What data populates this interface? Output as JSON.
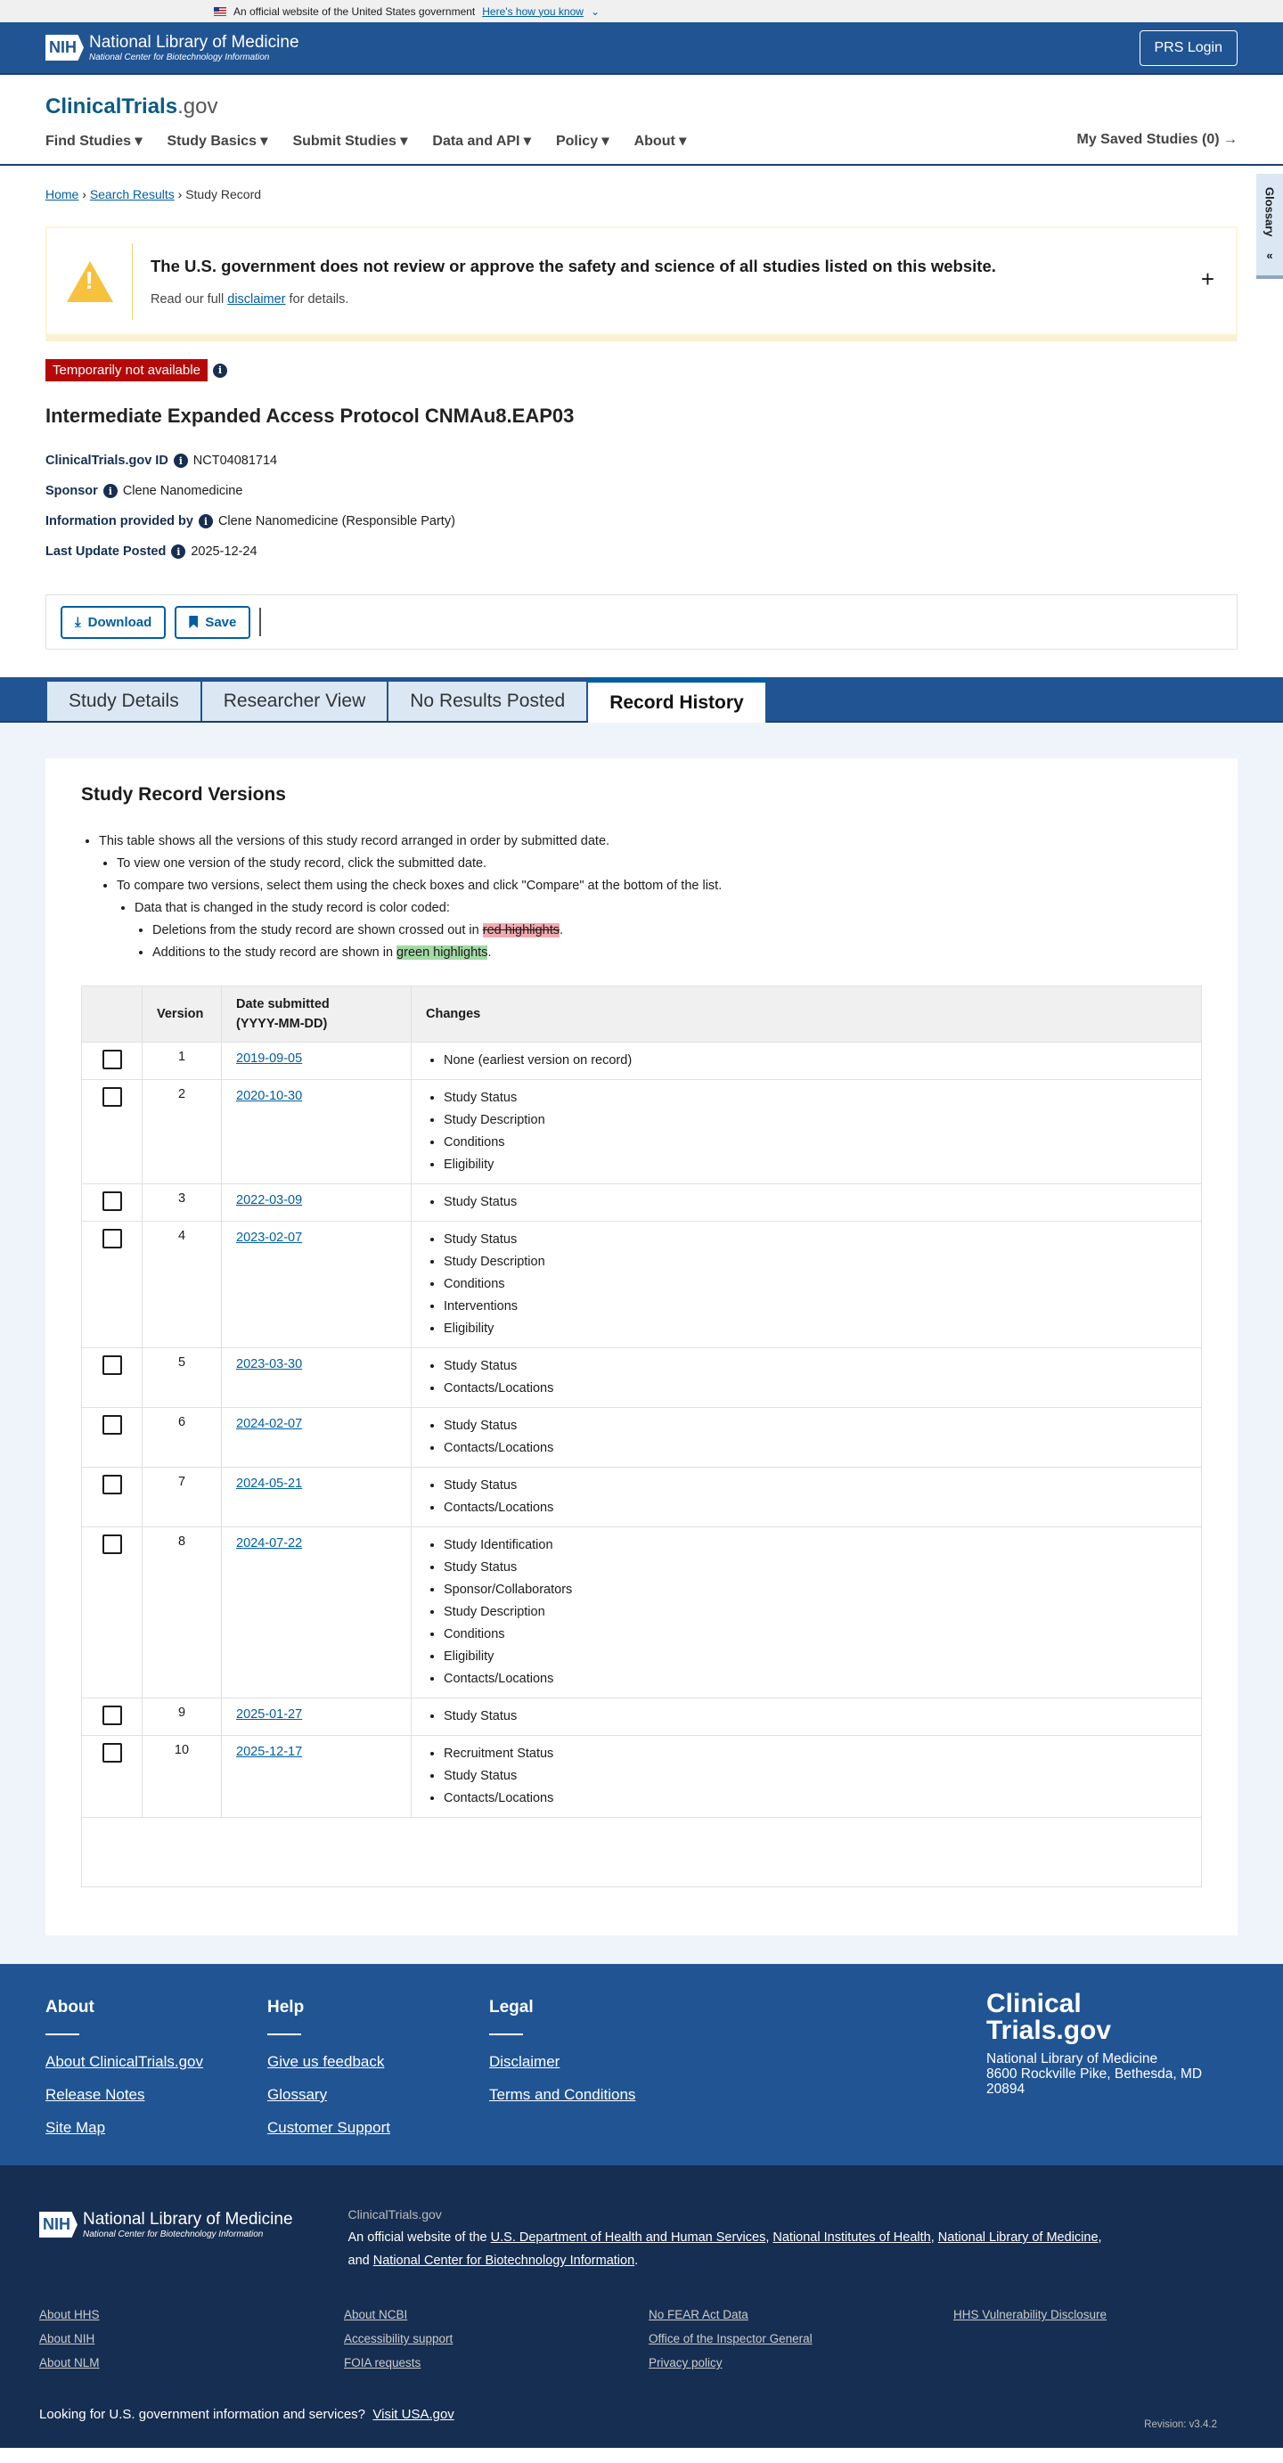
{
  "gov_banner": {
    "text": "An official website of the United States government",
    "link": "Here's how you know"
  },
  "header": {
    "nih_abbr": "NIH",
    "nih_name": "National Library of Medicine",
    "nih_sub": "National Center for Biotechnology Information",
    "prs_login": "PRS Login"
  },
  "site": {
    "logo_main": "ClinicalTrials",
    "logo_suffix": ".gov",
    "nav": [
      "Find Studies",
      "Study Basics",
      "Submit Studies",
      "Data and API",
      "Policy",
      "About"
    ],
    "saved": "My Saved Studies (0)"
  },
  "glossary": "Glossary",
  "breadcrumb": {
    "home": "Home",
    "search": "Search Results",
    "current": "Study Record"
  },
  "disclaimer": {
    "heading": "The U.S. government does not review or approve the safety and science of all studies listed on this website.",
    "pre": "Read our full ",
    "link": "disclaimer",
    "post": " for details."
  },
  "status_badge": "Temporarily not available",
  "study": {
    "title": "Intermediate Expanded Access Protocol CNMAu8.EAP03",
    "meta": [
      {
        "label": "ClinicalTrials.gov ID",
        "value": "NCT04081714"
      },
      {
        "label": "Sponsor",
        "value": "Clene Nanomedicine"
      },
      {
        "label": "Information provided by",
        "value": "Clene Nanomedicine (Responsible Party)"
      },
      {
        "label": "Last Update Posted",
        "value": "2025-12-24"
      }
    ]
  },
  "actions": {
    "download": "Download",
    "save": "Save"
  },
  "tabs": [
    "Study Details",
    "Researcher View",
    "No Results Posted",
    "Record History"
  ],
  "versions": {
    "heading": "Study Record Versions",
    "intro": "This table shows all the versions of this study record arranged in order by submitted date.",
    "view": "To view one version of the study record, click the submitted date.",
    "compare": "To compare two versions, select them using the check boxes and click \"Compare\" at the bottom of the list.",
    "coded": "Data that is changed in the study record is color coded:",
    "del_pre": "Deletions from the study record are shown crossed out in ",
    "del_hl": "red highlights",
    "add_pre": "Additions to the study record are shown in ",
    "add_hl": "green highlights",
    "col_version": "Version",
    "col_date": "Date submitted",
    "col_date_fmt": "(YYYY-MM-DD)",
    "col_changes": "Changes",
    "rows": [
      {
        "version": "1",
        "date": "2019-09-05",
        "changes": [
          "None (earliest version on record)"
        ]
      },
      {
        "version": "2",
        "date": "2020-10-30",
        "changes": [
          "Study Status",
          "Study Description",
          "Conditions",
          "Eligibility"
        ]
      },
      {
        "version": "3",
        "date": "2022-03-09",
        "changes": [
          "Study Status"
        ]
      },
      {
        "version": "4",
        "date": "2023-02-07",
        "changes": [
          "Study Status",
          "Study Description",
          "Conditions",
          "Interventions",
          "Eligibility"
        ]
      },
      {
        "version": "5",
        "date": "2023-03-30",
        "changes": [
          "Study Status",
          "Contacts/Locations"
        ]
      },
      {
        "version": "6",
        "date": "2024-02-07",
        "changes": [
          "Study Status",
          "Contacts/Locations"
        ]
      },
      {
        "version": "7",
        "date": "2024-05-21",
        "changes": [
          "Study Status",
          "Contacts/Locations"
        ]
      },
      {
        "version": "8",
        "date": "2024-07-22",
        "changes": [
          "Study Identification",
          "Study Status",
          "Sponsor/Collaborators",
          "Study Description",
          "Conditions",
          "Eligibility",
          "Contacts/Locations"
        ]
      },
      {
        "version": "9",
        "date": "2025-01-27",
        "changes": [
          "Study Status"
        ]
      },
      {
        "version": "10",
        "date": "2025-12-17",
        "changes": [
          "Recruitment Status",
          "Study Status",
          "Contacts/Locations"
        ]
      }
    ]
  },
  "footer": {
    "cols": [
      {
        "title": "About",
        "links": [
          "About ClinicalTrials.gov",
          "Release Notes",
          "Site Map"
        ]
      },
      {
        "title": "Help",
        "links": [
          "Give us feedback",
          "Glossary",
          "Customer Support"
        ]
      },
      {
        "title": "Legal",
        "links": [
          "Disclaimer",
          "Terms and Conditions"
        ]
      }
    ],
    "logo_l1": "Clinical",
    "logo_l2": "Trials.gov",
    "org": "National Library of Medicine",
    "addr1": "8600 Rockville Pike, Bethesda, MD",
    "addr2": "20894",
    "site_name": "ClinicalTrials.gov",
    "official_pre": "An official website of the ",
    "agencies": [
      "U.S. Department of Health and Human Services",
      "National Institutes of Health",
      "National Library of Medicine"
    ],
    "and": "and ",
    "ncbi": "National Center for Biotechnology Information",
    "links": [
      "About HHS",
      "About NCBI",
      "No FEAR Act Data",
      "HHS Vulnerability Disclosure",
      "About NIH",
      "Accessibility support",
      "Office of the Inspector General",
      "",
      "About NLM",
      "FOIA requests",
      "Privacy policy",
      ""
    ],
    "usa_q": "Looking for U.S. government information and services?",
    "usa_link": "Visit USA.gov",
    "revision": "Revision: v3.4.2"
  }
}
